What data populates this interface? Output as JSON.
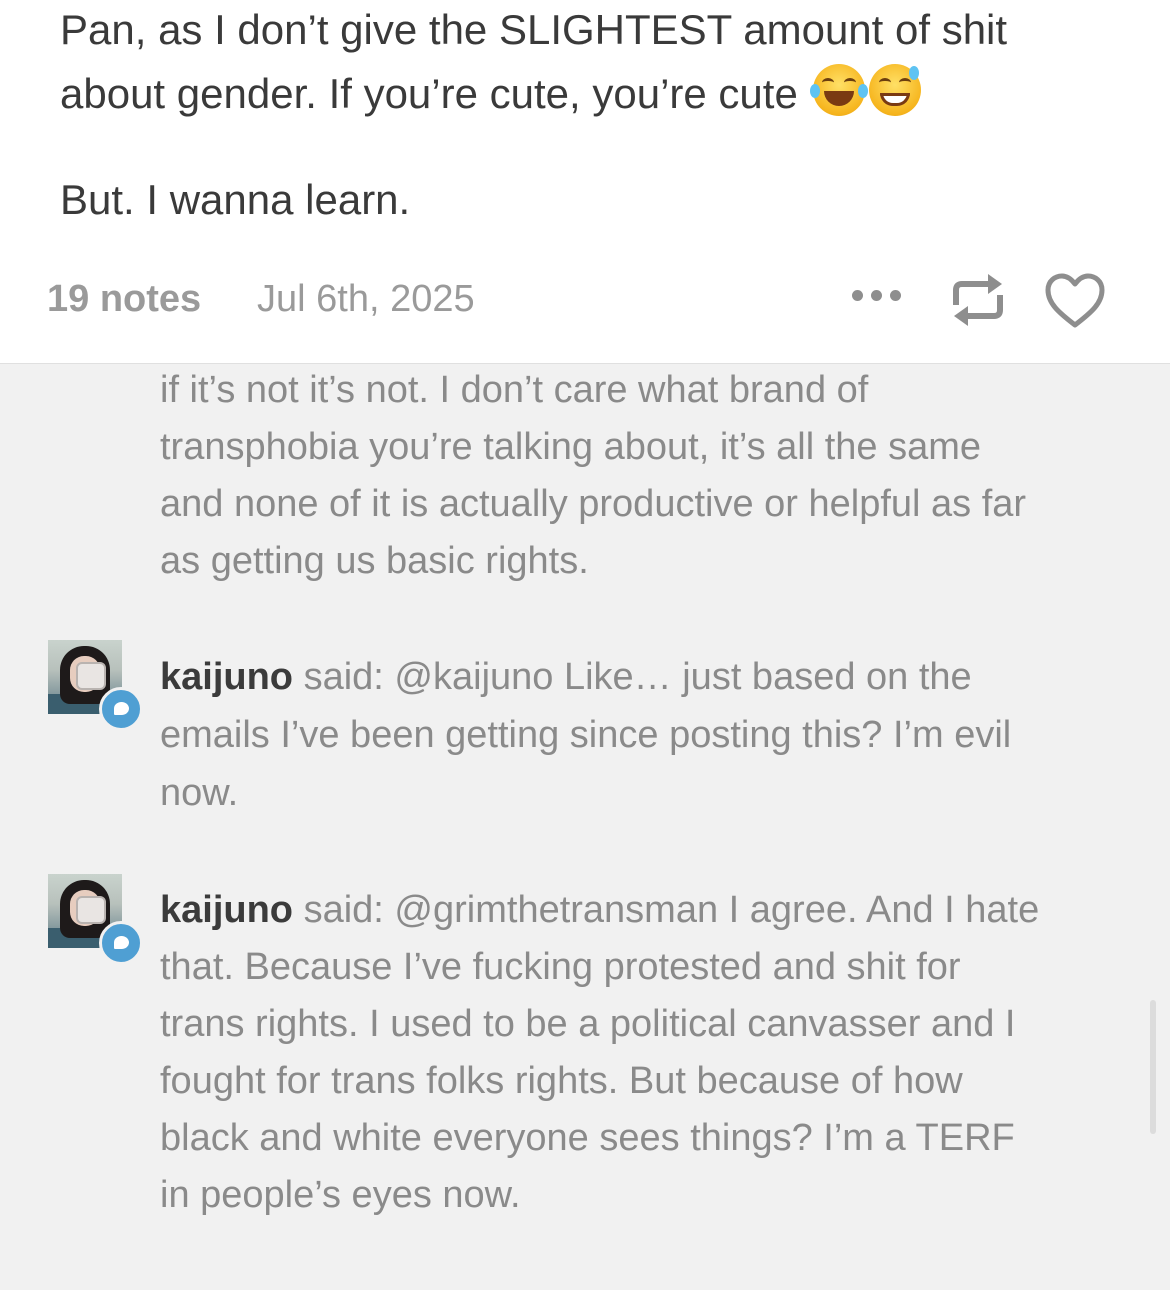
{
  "post": {
    "paragraph1": "Pan, as I don’t give the SLIGHTEST amount of shit about gender. If you’re cute, you’re cute",
    "emojis": [
      "face-with-tears-of-joy-emoji",
      "grinning-face-with-sweat-emoji"
    ],
    "paragraph2": "But. I wanna learn."
  },
  "meta": {
    "notes_count": "19 notes",
    "date": "Jul 6th, 2025"
  },
  "notes": {
    "previous_text": "if it’s not it’s not. I don’t care what brand of transphobia you’re talking about, it’s all the same and none of it is actually productive or helpful as far as getting us basic rights.",
    "items": [
      {
        "username": "kaijuno",
        "said": " said: ",
        "text": "@kaijuno Like… just based on the emails I’ve been getting since posting this? I’m evil now."
      },
      {
        "username": "kaijuno",
        "said": " said: ",
        "text": "@grimthetransman I agree. And I hate that. Because I’ve fucking protested and shit for trans rights. I used to be a political canvasser and I fought for trans folks rights. But because of how black and white everyone sees things? I’m a TERF in people’s eyes now."
      }
    ]
  },
  "colors": {
    "body_text": "#3a3a3a",
    "muted": "#9a9a9a",
    "panel_bg": "#f1f1f1",
    "reply_badge": "#4f9fd3"
  }
}
